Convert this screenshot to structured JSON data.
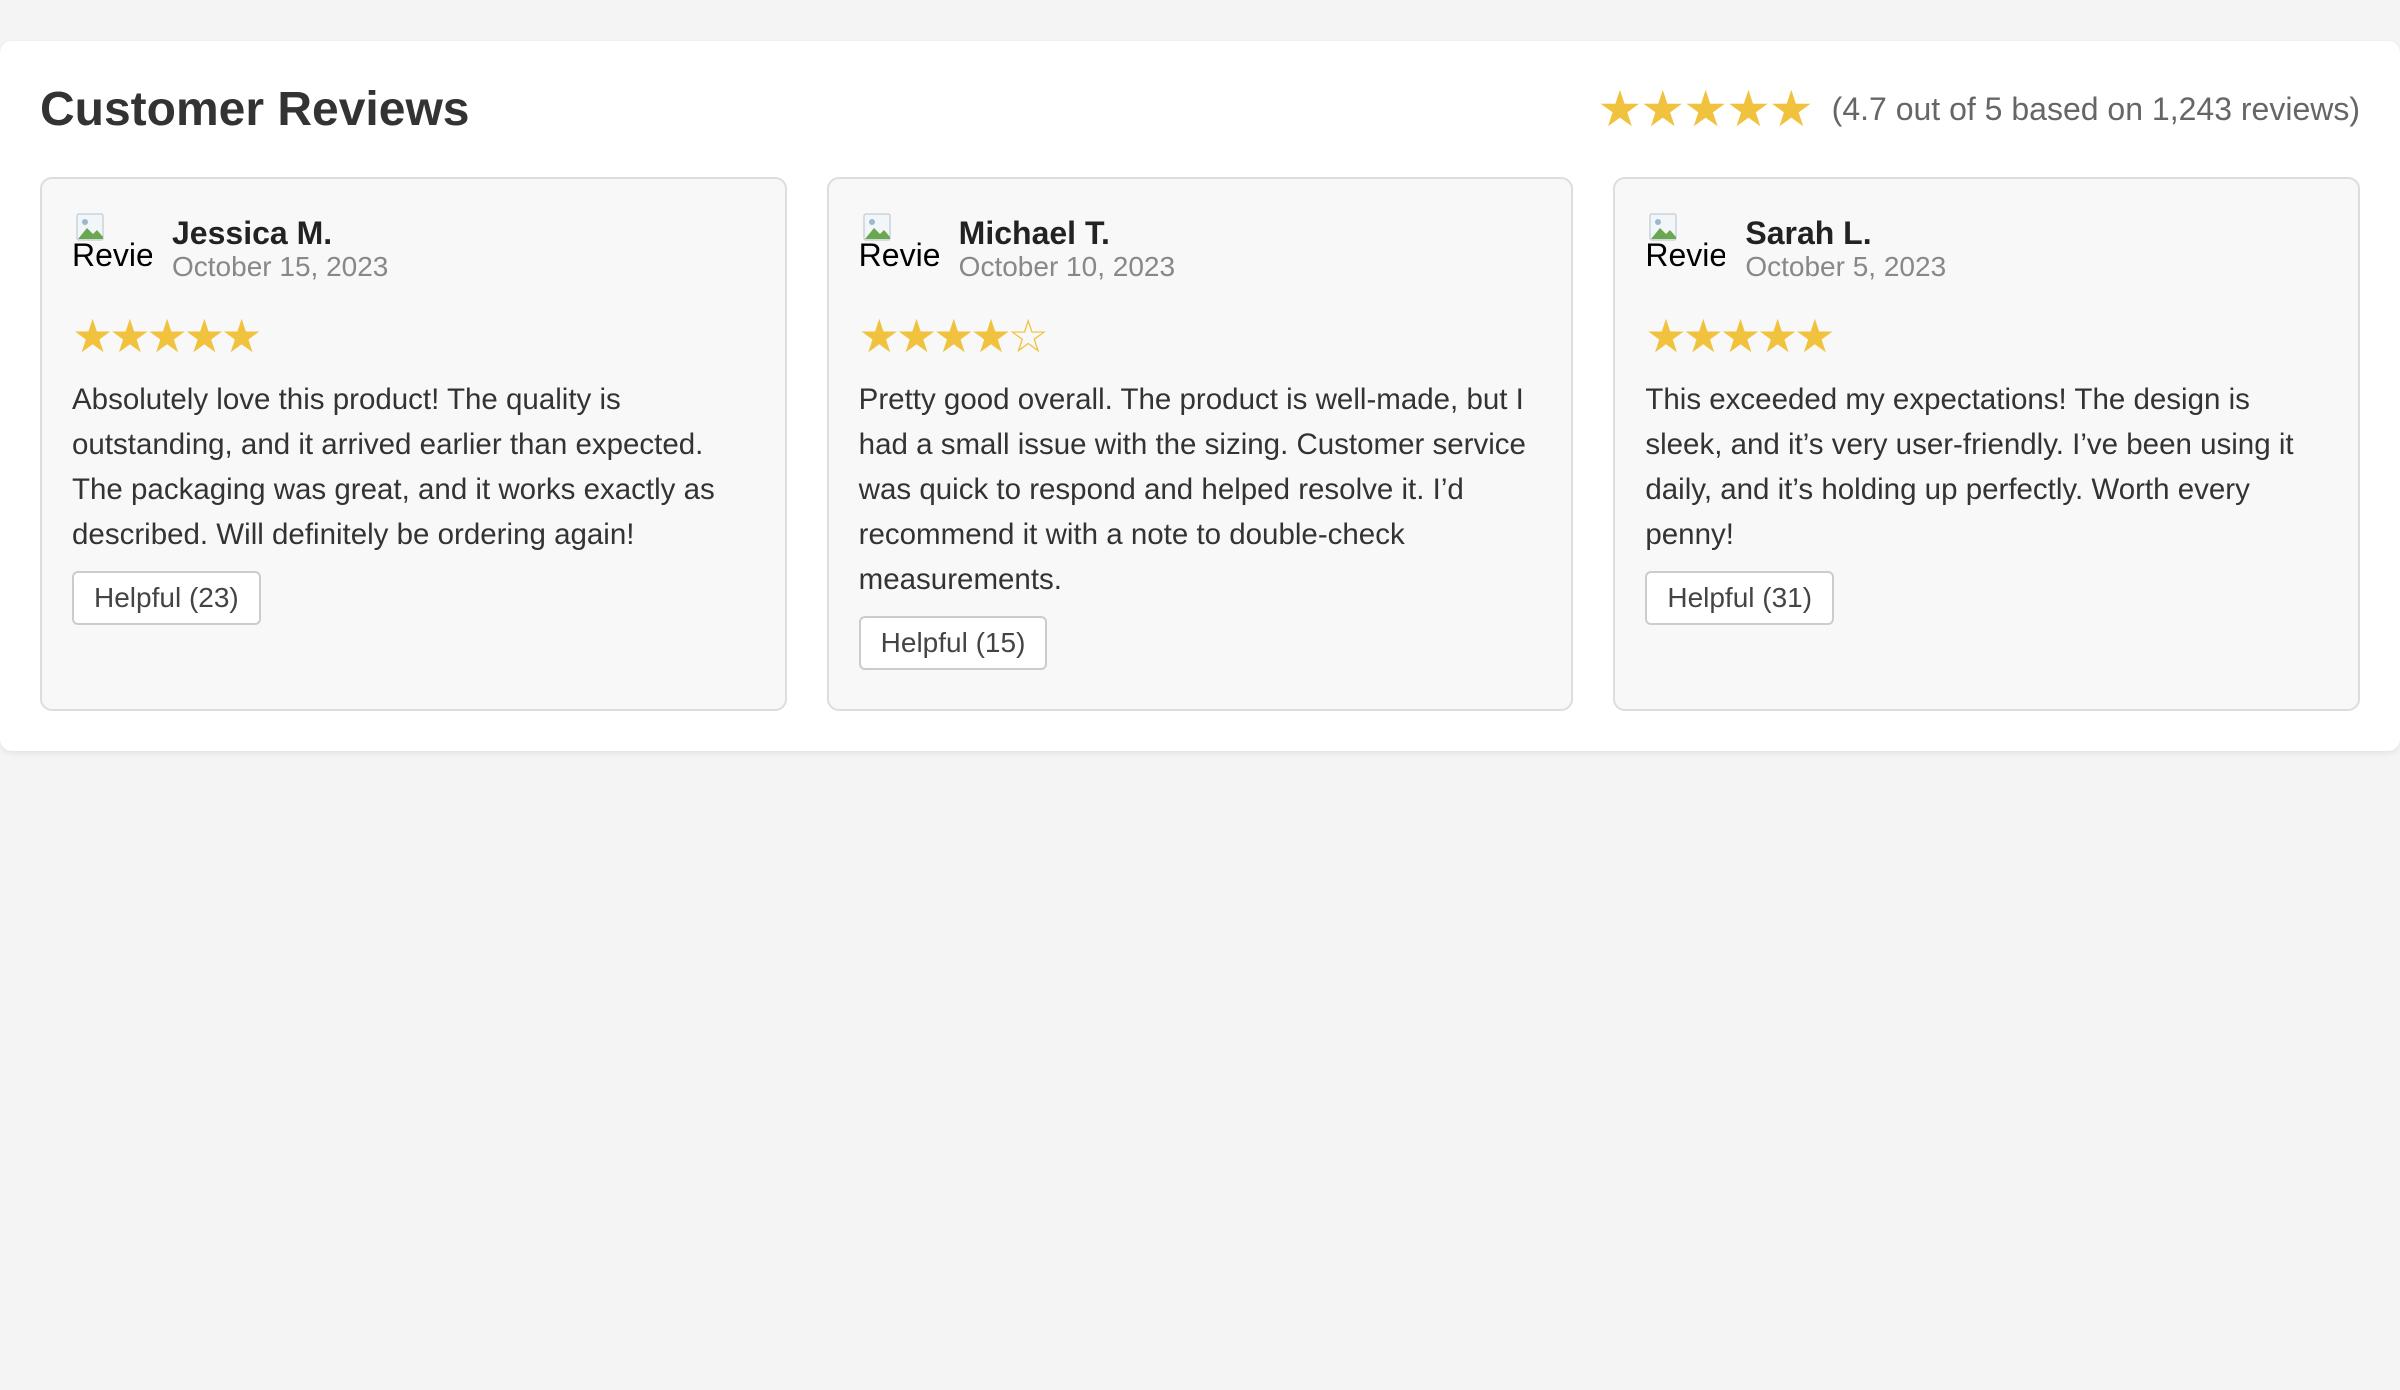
{
  "header": {
    "title": "Customer Reviews",
    "summary_stars": "★★★★★",
    "summary_rating": 4.7,
    "summary_text": "(4.7 out of 5 based on 1,243 reviews)"
  },
  "colors": {
    "star": "#f0c23e",
    "card_background": "#f8f8f8",
    "page_background": "#f4f4f4"
  },
  "reviews": [
    {
      "name": "Jessica M.",
      "date": "October 15, 2023",
      "avatar_alt": "Review",
      "stars": "★★★★★",
      "rating": 5,
      "text": "Absolutely love this product! The quality is outstanding, and it arrived earlier than expected. The packaging was great, and it works exactly as described. Will definitely be ordering again!",
      "helpful": "Helpful (23)"
    },
    {
      "name": "Michael T.",
      "date": "October 10, 2023",
      "avatar_alt": "Review",
      "stars": "★★★★☆",
      "rating": 4,
      "text": "Pretty good overall. The product is well-made, but I had a small issue with the sizing. Customer service was quick to respond and helped resolve it. I’d recommend it with a note to double-check measurements.",
      "helpful": "Helpful (15)"
    },
    {
      "name": "Sarah L.",
      "date": "October 5, 2023",
      "avatar_alt": "Review",
      "stars": "★★★★★",
      "rating": 5,
      "text": "This exceeded my expectations! The design is sleek, and it’s very user-friendly. I’ve been using it daily, and it’s holding up perfectly. Worth every penny!",
      "helpful": "Helpful (31)"
    }
  ]
}
